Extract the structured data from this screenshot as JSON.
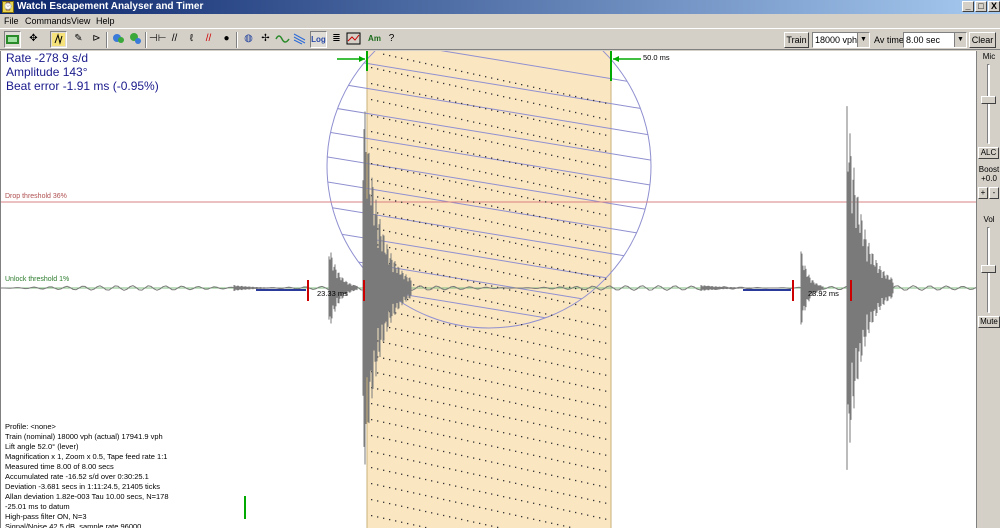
{
  "window": {
    "title": "Watch Escapement Analyser and Timer",
    "icon": "app-icon",
    "controls": [
      "_",
      "□",
      "X"
    ]
  },
  "menu": [
    "File",
    "Commands",
    "View",
    "Help"
  ],
  "toolbar": {
    "icons": [
      "run-icon",
      "move-icon",
      "signal-icon",
      "pencil-icon",
      "filter-icon",
      "settings-icon",
      "settings-alt-icon",
      "align-icon",
      "slash-icon",
      "pen-icon",
      "red-slash-icon",
      "drop-icon",
      "globe-icon",
      "crosshair-icon",
      "wave-icon",
      "waterfall-icon",
      "log-icon",
      "lines-icon",
      "chart-icon",
      "amplitude-icon",
      "help-icon"
    ],
    "log_label": "Log",
    "am_label": "Am",
    "train_button": "Train",
    "bph_value": "18000 vph",
    "av_time_label": "Av time",
    "av_time_value": "8.00 sec",
    "clear_button": "Clear"
  },
  "readout": {
    "rate": "Rate -278.9 s/d",
    "amplitude": "Amplitude 143°",
    "beat_error": "Beat error -1.91 ms (-0.95%)"
  },
  "scope": {
    "drop_threshold": "Drop threshold 36%",
    "unlock_threshold": "Unlock threshold 1%",
    "marker_label": "50.0 ms",
    "tick_label_1": "23.33 ms",
    "tick_label_2": "23.92 ms",
    "colors": {
      "paper_band": "#fbe6c2",
      "circle": "#8f8fd0",
      "drop_line": "#d98080",
      "unlock_line": "#7fbf7f",
      "trace": "#7a7a7a",
      "baseline": "#2a3a9a",
      "marker_red": "#cc0000",
      "marker_green": "#00aa00"
    }
  },
  "stats": [
    "Profile: <none>",
    "Train (nominal) 18000 vph (actual) 17941.9 vph",
    "Lift angle  52.0° (lever)",
    "Magnification x 1, Zoom x 0.5, Tape feed rate 1:1",
    "Measured time 8.00 of 8.00 secs",
    "Accumulated rate -16.52 s/d over 0:30:25.1",
    "Deviation -3.681 secs in 1:11:24.5, 21405 ticks",
    "Allan deviation 1.82e-003 Tau 10.00 secs, N=178",
    " -25.01 ms to datum",
    "High-pass filter ON, N=3",
    "Signal/Noise 42.5 dB, sample rate 96000"
  ],
  "side_panel": {
    "mic_label": "Mic",
    "alc_button": "ALC",
    "boost_label": "Boost",
    "boost_value": "+0.0",
    "plus_button": "+",
    "minus_button": "-",
    "vol_label": "Vol",
    "mute_button": "Mute"
  }
}
